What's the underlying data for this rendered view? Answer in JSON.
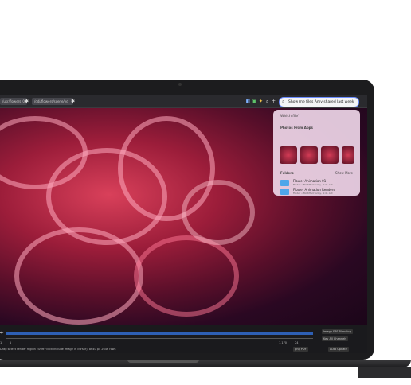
{
  "menubar": {
    "tabs": [
      {
        "label": "/usr/flowers_03.f"
      },
      {
        "label": "/ddj/flowers/scene/vd"
      }
    ],
    "search": {
      "value": "Show me files Amy shared last week"
    }
  },
  "spotlight": {
    "header": "Which file?",
    "photos_title": "Photos From Apps",
    "folders_title": "Folders",
    "show_more": "Show More",
    "folders": [
      {
        "title": "Flower Animation 01",
        "subtitle": "Finder • Modified today, 9:41 AM"
      },
      {
        "title": "Flower Animation Renders",
        "subtitle": "Finder • Modified today, 9:41 AM"
      }
    ]
  },
  "timeline": {
    "frame_start": "1",
    "frame_current": "1",
    "range_end": "1,170",
    "fps": "24",
    "status": "Drag select render region (Shift+click include image in cursor), 8640 px 2646 rows",
    "mode": "Image FPS Blending",
    "playback": "Key All Channels",
    "export": "png PDF",
    "update": "Auto Update"
  }
}
